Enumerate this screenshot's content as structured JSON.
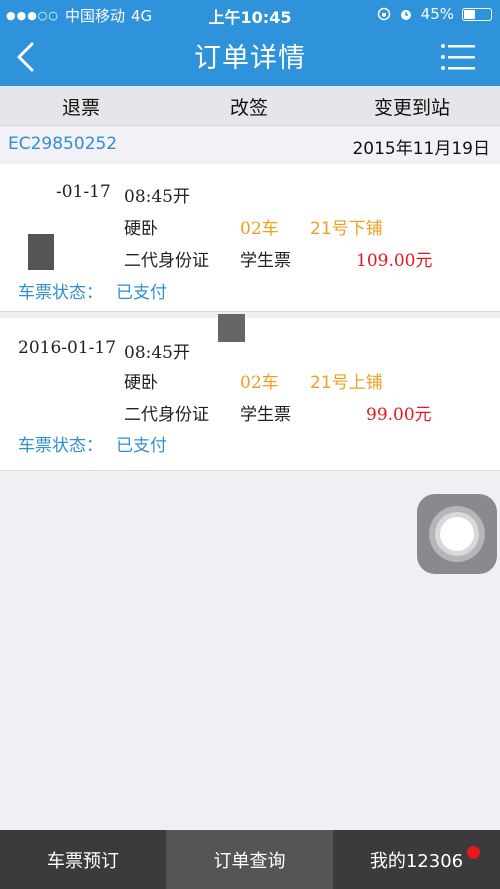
{
  "status_bar": {
    "signal": "●●●○○",
    "carrier": "中国移动",
    "network": "4G",
    "time": "上午10:45",
    "battery": "45%",
    "battery_level": 0.45
  },
  "nav": {
    "title": "订单详情"
  },
  "actions": {
    "refund": "退票",
    "change": "改签",
    "change_station": "变更到站"
  },
  "order": {
    "number": "EC29850252",
    "date": "2015年11月19日"
  },
  "tickets": [
    {
      "date": "2016-01-17",
      "date_visible": "-01-17",
      "time": "08:45开",
      "seat_type": "硬卧",
      "car": "02车",
      "berth": "21号下铺",
      "id_type": "二代身份证",
      "ticket_type": "学生票",
      "price": "109.00元",
      "status_label": "车票状态：",
      "status": "已支付"
    },
    {
      "date": "2016-01-17",
      "time": "08:45开",
      "seat_type": "硬卧",
      "car": "02车",
      "berth": "21号上铺",
      "id_type": "二代身份证",
      "ticket_type": "学生票",
      "price": "99.00元",
      "status_label": "车票状态：",
      "status": "已支付"
    }
  ],
  "tabs": {
    "book": "车票预订",
    "orders": "订单查询",
    "mine": "我的12306"
  },
  "colors": {
    "header_blue": "#2f93dc",
    "link_blue": "#2f8fd0",
    "orange": "#f0a020",
    "price_red": "#e8171e"
  }
}
